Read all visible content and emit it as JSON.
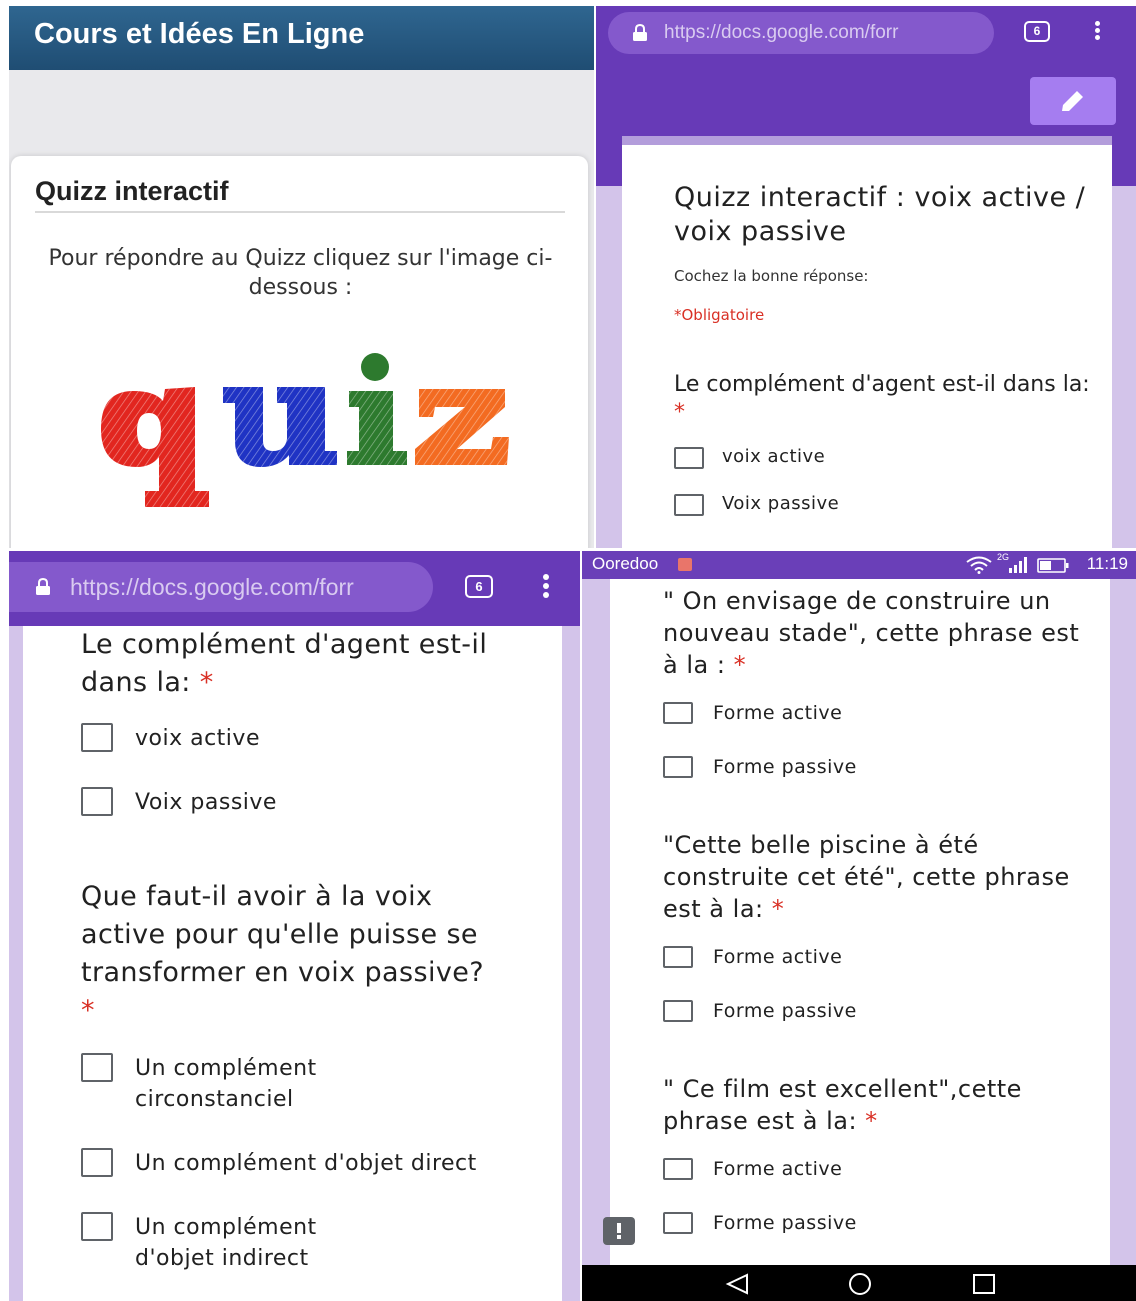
{
  "panel1": {
    "site_title": "Cours et Idées En Ligne",
    "card_title": "Quizz interactif",
    "card_text": "Pour répondre au Quizz cliquez sur l'image ci-dessous :",
    "quiz_image": {
      "text": "quiz",
      "letters": [
        {
          "char": "q",
          "color": "#e2261f"
        },
        {
          "char": "u",
          "color": "#1f33c4"
        },
        {
          "char": "i",
          "color": "#2d7a2e"
        },
        {
          "char": "z",
          "color": "#f36b21"
        }
      ]
    }
  },
  "panel2": {
    "url": "https://docs.google.com/forr",
    "tab_count": "6",
    "form_title": "Quizz interactif : voix active / voix passive",
    "form_description": "Cochez la bonne réponse:",
    "required_note": "*Obligatoire",
    "questions": [
      {
        "title": "Le complément d'agent est-il dans la:",
        "options": [
          "voix active",
          "Voix passive"
        ]
      }
    ]
  },
  "panel3": {
    "url": "https://docs.google.com/forr",
    "tab_count": "6",
    "questions": [
      {
        "title": "Le complément d'agent est-il dans la:",
        "options": [
          "voix active",
          "Voix passive"
        ]
      },
      {
        "title": "Que faut-il avoir à la voix active pour qu'elle puisse se transformer en voix passive?",
        "options": [
          "Un complément circonstanciel",
          "Un complément d'objet direct",
          "Un complément d'objet indirect"
        ]
      }
    ]
  },
  "panel4": {
    "status": {
      "carrier": "Ooredoo",
      "network": "2G",
      "time": "11:19"
    },
    "questions": [
      {
        "title": "\" On envisage de construire un nouveau stade\", cette phrase est à la :",
        "options": [
          "Forme active",
          "Forme passive"
        ]
      },
      {
        "title": "\"Cette belle piscine à été construite cet été\", cette phrase est à la:",
        "options": [
          "Forme active",
          "Forme passive"
        ]
      },
      {
        "title": "\" Ce film est excellent\",cette phrase est à la:",
        "options": [
          "Forme active",
          "Forme passive"
        ]
      }
    ]
  },
  "colors": {
    "site_header": "#2f6690",
    "forms_purple": "#673ab7",
    "form_background": "#d3c4ea",
    "required_red": "#d93025"
  },
  "required_marker": "*"
}
